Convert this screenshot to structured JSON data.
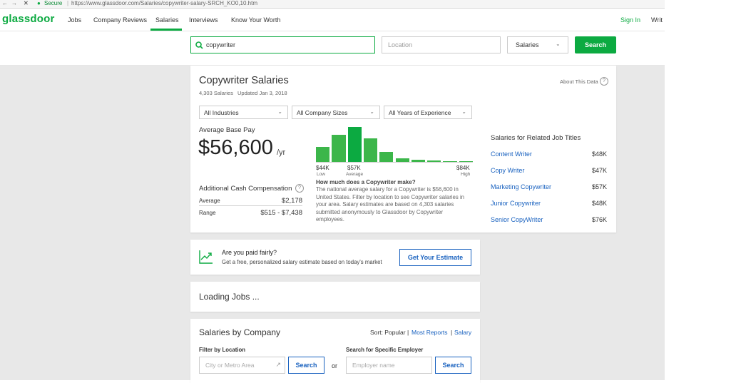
{
  "browser": {
    "secure_label": "Secure",
    "url": "https://www.glassdoor.com/Salaries/copywriter-salary-SRCH_KO0,10.htm"
  },
  "nav": {
    "logo": "glassdoor",
    "items": [
      "Jobs",
      "Company Reviews",
      "Salaries",
      "Interviews",
      "Know Your Worth"
    ],
    "sign_in": "Sign In",
    "write": "Writ"
  },
  "search": {
    "keyword_value": "copywriter",
    "location_placeholder": "Location",
    "category_value": "Salaries",
    "button": "Search"
  },
  "summary": {
    "title": "Copywriter Salaries",
    "count": "4,303 Salaries",
    "updated": "Updated Jan 3, 2018",
    "about_data": "About This Data",
    "filters": [
      "All Industries",
      "All Company Sizes",
      "All Years of Experience"
    ],
    "avg_label": "Average Base Pay",
    "avg_value": "$56,600",
    "avg_unit": "/yr",
    "histogram_levels": [
      0.42,
      0.78,
      1.0,
      0.68,
      0.28,
      0.1,
      0.06,
      0.04,
      0.03,
      0.03
    ],
    "low_value": "$44K",
    "low_label": "Low",
    "avg_hist_value": "$57K",
    "avg_hist_label": "Average",
    "high_value": "$84K",
    "high_label": "High",
    "question": "How much does a Copywriter make?",
    "description": "The national average salary for a Copywriter is $56,600 in United States. Filter by location to see Copywriter salaries in your area. Salary estimates are based on 4,303 salaries submitted anonymously to Glassdoor by Copywriter employees.",
    "cash_title": "Additional Cash Compensation",
    "cash_rows": [
      {
        "label": "Average",
        "value": "$2,178"
      },
      {
        "label": "Range",
        "value": "$515 - $7,438"
      }
    ],
    "related_title": "Salaries for Related Job Titles",
    "related": [
      {
        "title": "Content Writer",
        "salary": "$48K"
      },
      {
        "title": "Copy Writer",
        "salary": "$47K"
      },
      {
        "title": "Marketing Copywriter",
        "salary": "$57K"
      },
      {
        "title": "Junior Copywriter",
        "salary": "$48K"
      },
      {
        "title": "Senior CopyWriter",
        "salary": "$76K"
      }
    ]
  },
  "fair": {
    "title": "Are you paid fairly?",
    "subtitle": "Get a free, personalized salary estimate based on today's market",
    "button": "Get Your Estimate"
  },
  "loading": {
    "text": "Loading Jobs ..."
  },
  "by_company": {
    "title": "Salaries by Company",
    "sort_label": "Sort: Popular |",
    "sort_most": "Most Reports",
    "sort_sep": "|",
    "sort_salary": "Salary",
    "filter_label": "Filter by Location",
    "filter_placeholder": "City or Metro Area",
    "search_button": "Search",
    "or": "or",
    "employer_label": "Search for Specific Employer",
    "employer_placeholder": "Employer name",
    "employer_button": "Search"
  }
}
